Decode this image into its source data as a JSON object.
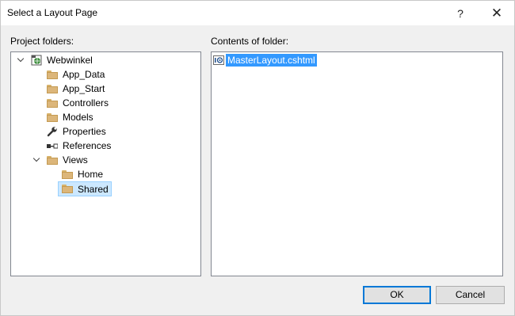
{
  "window": {
    "title": "Select a Layout Page"
  },
  "titlebar": {
    "help_glyph": "?",
    "close_glyph": "✕"
  },
  "left_panel": {
    "label": "Project folders:",
    "tree": [
      {
        "label": "Webwinkel",
        "icon": "project-icon",
        "expanded": true
      },
      {
        "label": "App_Data",
        "icon": "folder-icon"
      },
      {
        "label": "App_Start",
        "icon": "folder-icon"
      },
      {
        "label": "Controllers",
        "icon": "folder-icon"
      },
      {
        "label": "Models",
        "icon": "folder-icon"
      },
      {
        "label": "Properties",
        "icon": "wrench-icon"
      },
      {
        "label": "References",
        "icon": "references-icon"
      },
      {
        "label": "Views",
        "icon": "folder-icon",
        "expanded": true
      },
      {
        "label": "Home",
        "icon": "folder-icon"
      },
      {
        "label": "Shared",
        "icon": "folder-icon",
        "selected": true
      }
    ]
  },
  "right_panel": {
    "label": "Contents of folder:",
    "files": [
      {
        "label": "MasterLayout.cshtml",
        "icon": "razor-file-icon",
        "selected": true
      }
    ]
  },
  "buttons": {
    "ok": "OK",
    "cancel": "Cancel"
  },
  "colors": {
    "selection": "#3399ff",
    "tree_selection": "#cce8ff",
    "default_button_border": "#0078d7"
  }
}
